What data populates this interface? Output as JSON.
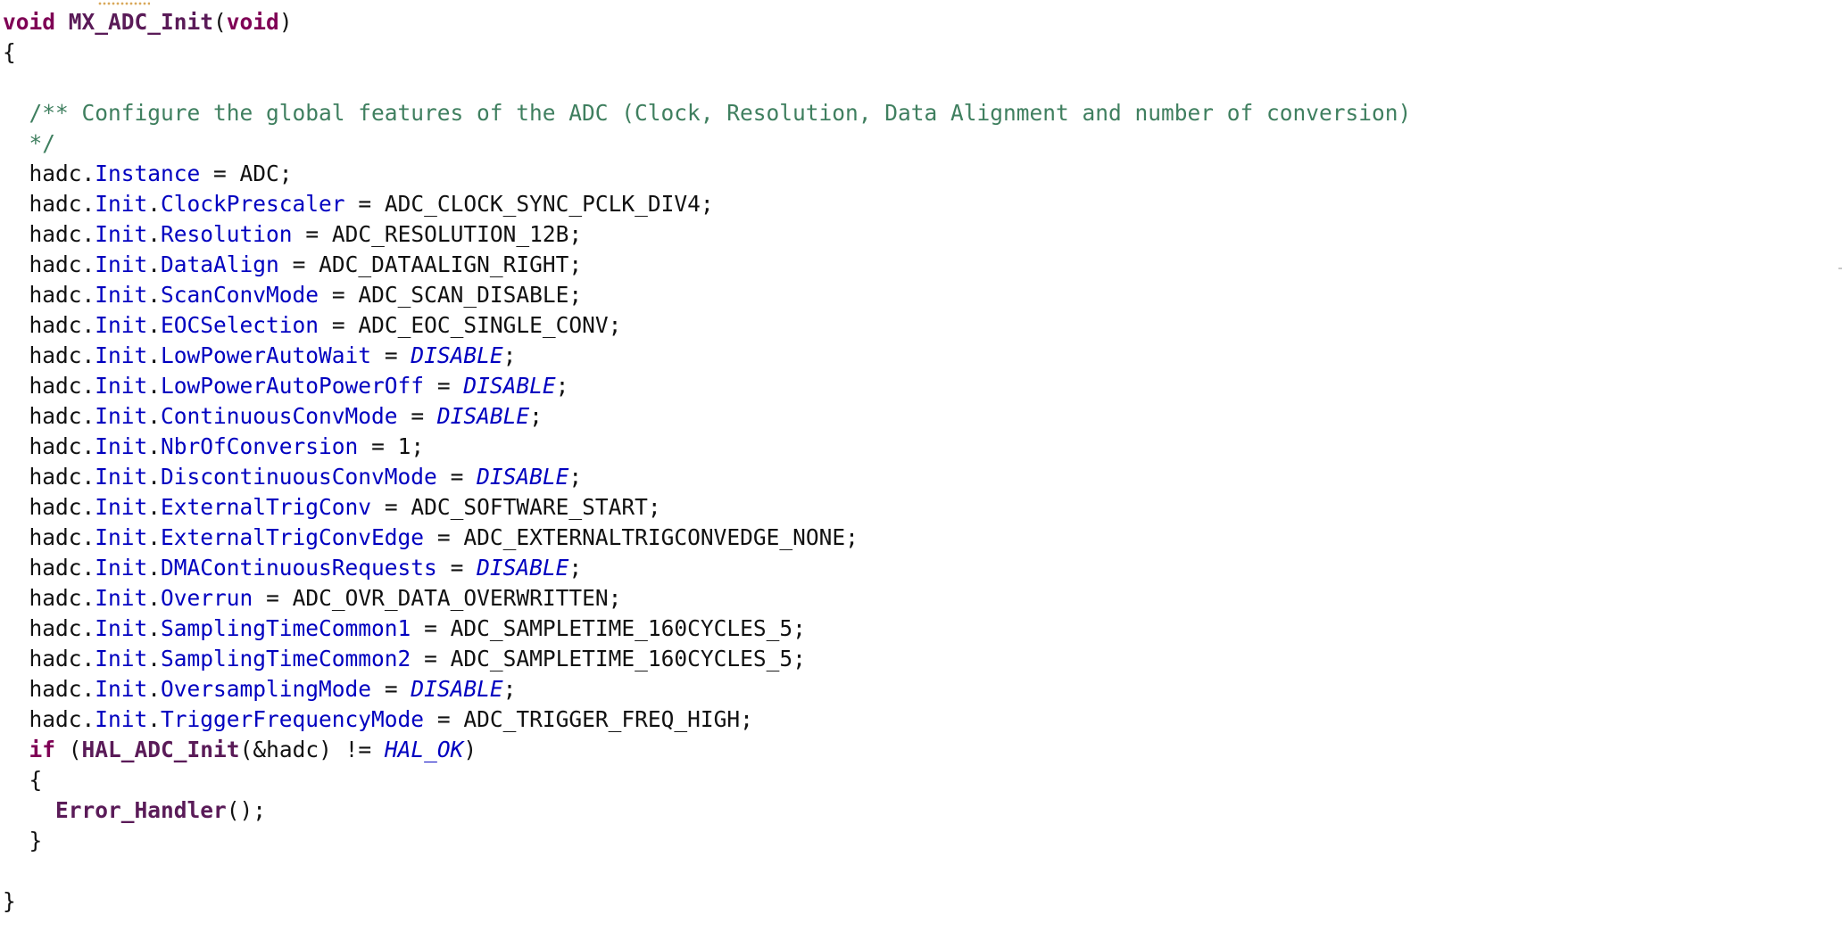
{
  "editor": {
    "lines": [
      [
        {
          "t": "void",
          "c": "kw"
        },
        {
          "t": " MX_ADC_Init",
          "c": "fn"
        },
        {
          "t": "(",
          "c": ""
        },
        {
          "t": "void",
          "c": "kw"
        },
        {
          "t": ")",
          "c": ""
        }
      ],
      [
        {
          "t": "{",
          "c": ""
        }
      ],
      [
        {
          "t": "",
          "c": ""
        }
      ],
      [
        {
          "t": "  /** Configure the global features of the ADC (Clock, Resolution, Data Alignment and number of conversion)",
          "c": "cmt"
        }
      ],
      [
        {
          "t": "  */",
          "c": "cmt"
        }
      ],
      [
        {
          "t": "  hadc.",
          "c": ""
        },
        {
          "t": "Instance",
          "c": "fld"
        },
        {
          "t": " = ADC;",
          "c": ""
        }
      ],
      [
        {
          "t": "  hadc.",
          "c": ""
        },
        {
          "t": "Init",
          "c": "fld"
        },
        {
          "t": ".",
          "c": ""
        },
        {
          "t": "ClockPrescaler",
          "c": "fld"
        },
        {
          "t": " = ADC_CLOCK_SYNC_PCLK_DIV4;",
          "c": ""
        }
      ],
      [
        {
          "t": "  hadc.",
          "c": ""
        },
        {
          "t": "Init",
          "c": "fld"
        },
        {
          "t": ".",
          "c": ""
        },
        {
          "t": "Resolution",
          "c": "fld"
        },
        {
          "t": " = ADC_RESOLUTION_12B;",
          "c": ""
        }
      ],
      [
        {
          "t": "  hadc.",
          "c": ""
        },
        {
          "t": "Init",
          "c": "fld"
        },
        {
          "t": ".",
          "c": ""
        },
        {
          "t": "DataAlign",
          "c": "fld"
        },
        {
          "t": " = ADC_DATAALIGN_RIGHT;",
          "c": ""
        }
      ],
      [
        {
          "t": "  hadc.",
          "c": ""
        },
        {
          "t": "Init",
          "c": "fld"
        },
        {
          "t": ".",
          "c": ""
        },
        {
          "t": "ScanConvMode",
          "c": "fld"
        },
        {
          "t": " = ADC_SCAN_DISABLE;",
          "c": ""
        }
      ],
      [
        {
          "t": "  hadc.",
          "c": ""
        },
        {
          "t": "Init",
          "c": "fld"
        },
        {
          "t": ".",
          "c": ""
        },
        {
          "t": "EOCSelection",
          "c": "fld"
        },
        {
          "t": " = ADC_EOC_SINGLE_CONV;",
          "c": ""
        }
      ],
      [
        {
          "t": "  hadc.",
          "c": ""
        },
        {
          "t": "Init",
          "c": "fld"
        },
        {
          "t": ".",
          "c": ""
        },
        {
          "t": "LowPowerAutoWait",
          "c": "fld"
        },
        {
          "t": " = ",
          "c": ""
        },
        {
          "t": "DISABLE",
          "c": "cnst"
        },
        {
          "t": ";",
          "c": ""
        }
      ],
      [
        {
          "t": "  hadc.",
          "c": ""
        },
        {
          "t": "Init",
          "c": "fld"
        },
        {
          "t": ".",
          "c": ""
        },
        {
          "t": "LowPowerAutoPowerOff",
          "c": "fld"
        },
        {
          "t": " = ",
          "c": ""
        },
        {
          "t": "DISABLE",
          "c": "cnst"
        },
        {
          "t": ";",
          "c": ""
        }
      ],
      [
        {
          "t": "  hadc.",
          "c": ""
        },
        {
          "t": "Init",
          "c": "fld"
        },
        {
          "t": ".",
          "c": ""
        },
        {
          "t": "ContinuousConvMode",
          "c": "fld"
        },
        {
          "t": " = ",
          "c": ""
        },
        {
          "t": "DISABLE",
          "c": "cnst"
        },
        {
          "t": ";",
          "c": ""
        }
      ],
      [
        {
          "t": "  hadc.",
          "c": ""
        },
        {
          "t": "Init",
          "c": "fld"
        },
        {
          "t": ".",
          "c": ""
        },
        {
          "t": "NbrOfConversion",
          "c": "fld"
        },
        {
          "t": " = 1;",
          "c": ""
        }
      ],
      [
        {
          "t": "  hadc.",
          "c": ""
        },
        {
          "t": "Init",
          "c": "fld"
        },
        {
          "t": ".",
          "c": ""
        },
        {
          "t": "DiscontinuousConvMode",
          "c": "fld"
        },
        {
          "t": " = ",
          "c": ""
        },
        {
          "t": "DISABLE",
          "c": "cnst"
        },
        {
          "t": ";",
          "c": ""
        }
      ],
      [
        {
          "t": "  hadc.",
          "c": ""
        },
        {
          "t": "Init",
          "c": "fld"
        },
        {
          "t": ".",
          "c": ""
        },
        {
          "t": "ExternalTrigConv",
          "c": "fld"
        },
        {
          "t": " = ADC_SOFTWARE_START;",
          "c": ""
        }
      ],
      [
        {
          "t": "  hadc.",
          "c": ""
        },
        {
          "t": "Init",
          "c": "fld"
        },
        {
          "t": ".",
          "c": ""
        },
        {
          "t": "ExternalTrigConvEdge",
          "c": "fld"
        },
        {
          "t": " = ADC_EXTERNALTRIGCONVEDGE_NONE;",
          "c": ""
        }
      ],
      [
        {
          "t": "  hadc.",
          "c": ""
        },
        {
          "t": "Init",
          "c": "fld"
        },
        {
          "t": ".",
          "c": ""
        },
        {
          "t": "DMAContinuousRequests",
          "c": "fld"
        },
        {
          "t": " = ",
          "c": ""
        },
        {
          "t": "DISABLE",
          "c": "cnst"
        },
        {
          "t": ";",
          "c": ""
        }
      ],
      [
        {
          "t": "  hadc.",
          "c": ""
        },
        {
          "t": "Init",
          "c": "fld"
        },
        {
          "t": ".",
          "c": ""
        },
        {
          "t": "Overrun",
          "c": "fld"
        },
        {
          "t": " = ADC_OVR_DATA_OVERWRITTEN;",
          "c": ""
        }
      ],
      [
        {
          "t": "  hadc.",
          "c": ""
        },
        {
          "t": "Init",
          "c": "fld"
        },
        {
          "t": ".",
          "c": ""
        },
        {
          "t": "SamplingTimeCommon1",
          "c": "fld"
        },
        {
          "t": " = ADC_SAMPLETIME_160CYCLES_5;",
          "c": ""
        }
      ],
      [
        {
          "t": "  hadc.",
          "c": ""
        },
        {
          "t": "Init",
          "c": "fld"
        },
        {
          "t": ".",
          "c": ""
        },
        {
          "t": "SamplingTimeCommon2",
          "c": "fld"
        },
        {
          "t": " = ADC_SAMPLETIME_160CYCLES_5;",
          "c": ""
        }
      ],
      [
        {
          "t": "  hadc.",
          "c": ""
        },
        {
          "t": "Init",
          "c": "fld"
        },
        {
          "t": ".",
          "c": ""
        },
        {
          "t": "OversamplingMode",
          "c": "fld"
        },
        {
          "t": " = ",
          "c": ""
        },
        {
          "t": "DISABLE",
          "c": "cnst"
        },
        {
          "t": ";",
          "c": ""
        }
      ],
      [
        {
          "t": "  hadc.",
          "c": ""
        },
        {
          "t": "Init",
          "c": "fld"
        },
        {
          "t": ".",
          "c": ""
        },
        {
          "t": "TriggerFrequencyMode",
          "c": "fld"
        },
        {
          "t": " = ADC_TRIGGER_FREQ_HIGH;",
          "c": ""
        }
      ],
      [
        {
          "t": "  ",
          "c": ""
        },
        {
          "t": "if",
          "c": "kw"
        },
        {
          "t": " (",
          "c": ""
        },
        {
          "t": "HAL_ADC_Init",
          "c": "fn"
        },
        {
          "t": "(&hadc) != ",
          "c": ""
        },
        {
          "t": "HAL_OK",
          "c": "cnst"
        },
        {
          "t": ")",
          "c": ""
        }
      ],
      [
        {
          "t": "  {",
          "c": ""
        }
      ],
      [
        {
          "t": "    ",
          "c": ""
        },
        {
          "t": "Error_Handler",
          "c": "fn"
        },
        {
          "t": "();",
          "c": ""
        }
      ],
      [
        {
          "t": "  }",
          "c": ""
        }
      ],
      [
        {
          "t": "",
          "c": ""
        }
      ],
      [
        {
          "t": "}",
          "c": ""
        }
      ]
    ]
  }
}
